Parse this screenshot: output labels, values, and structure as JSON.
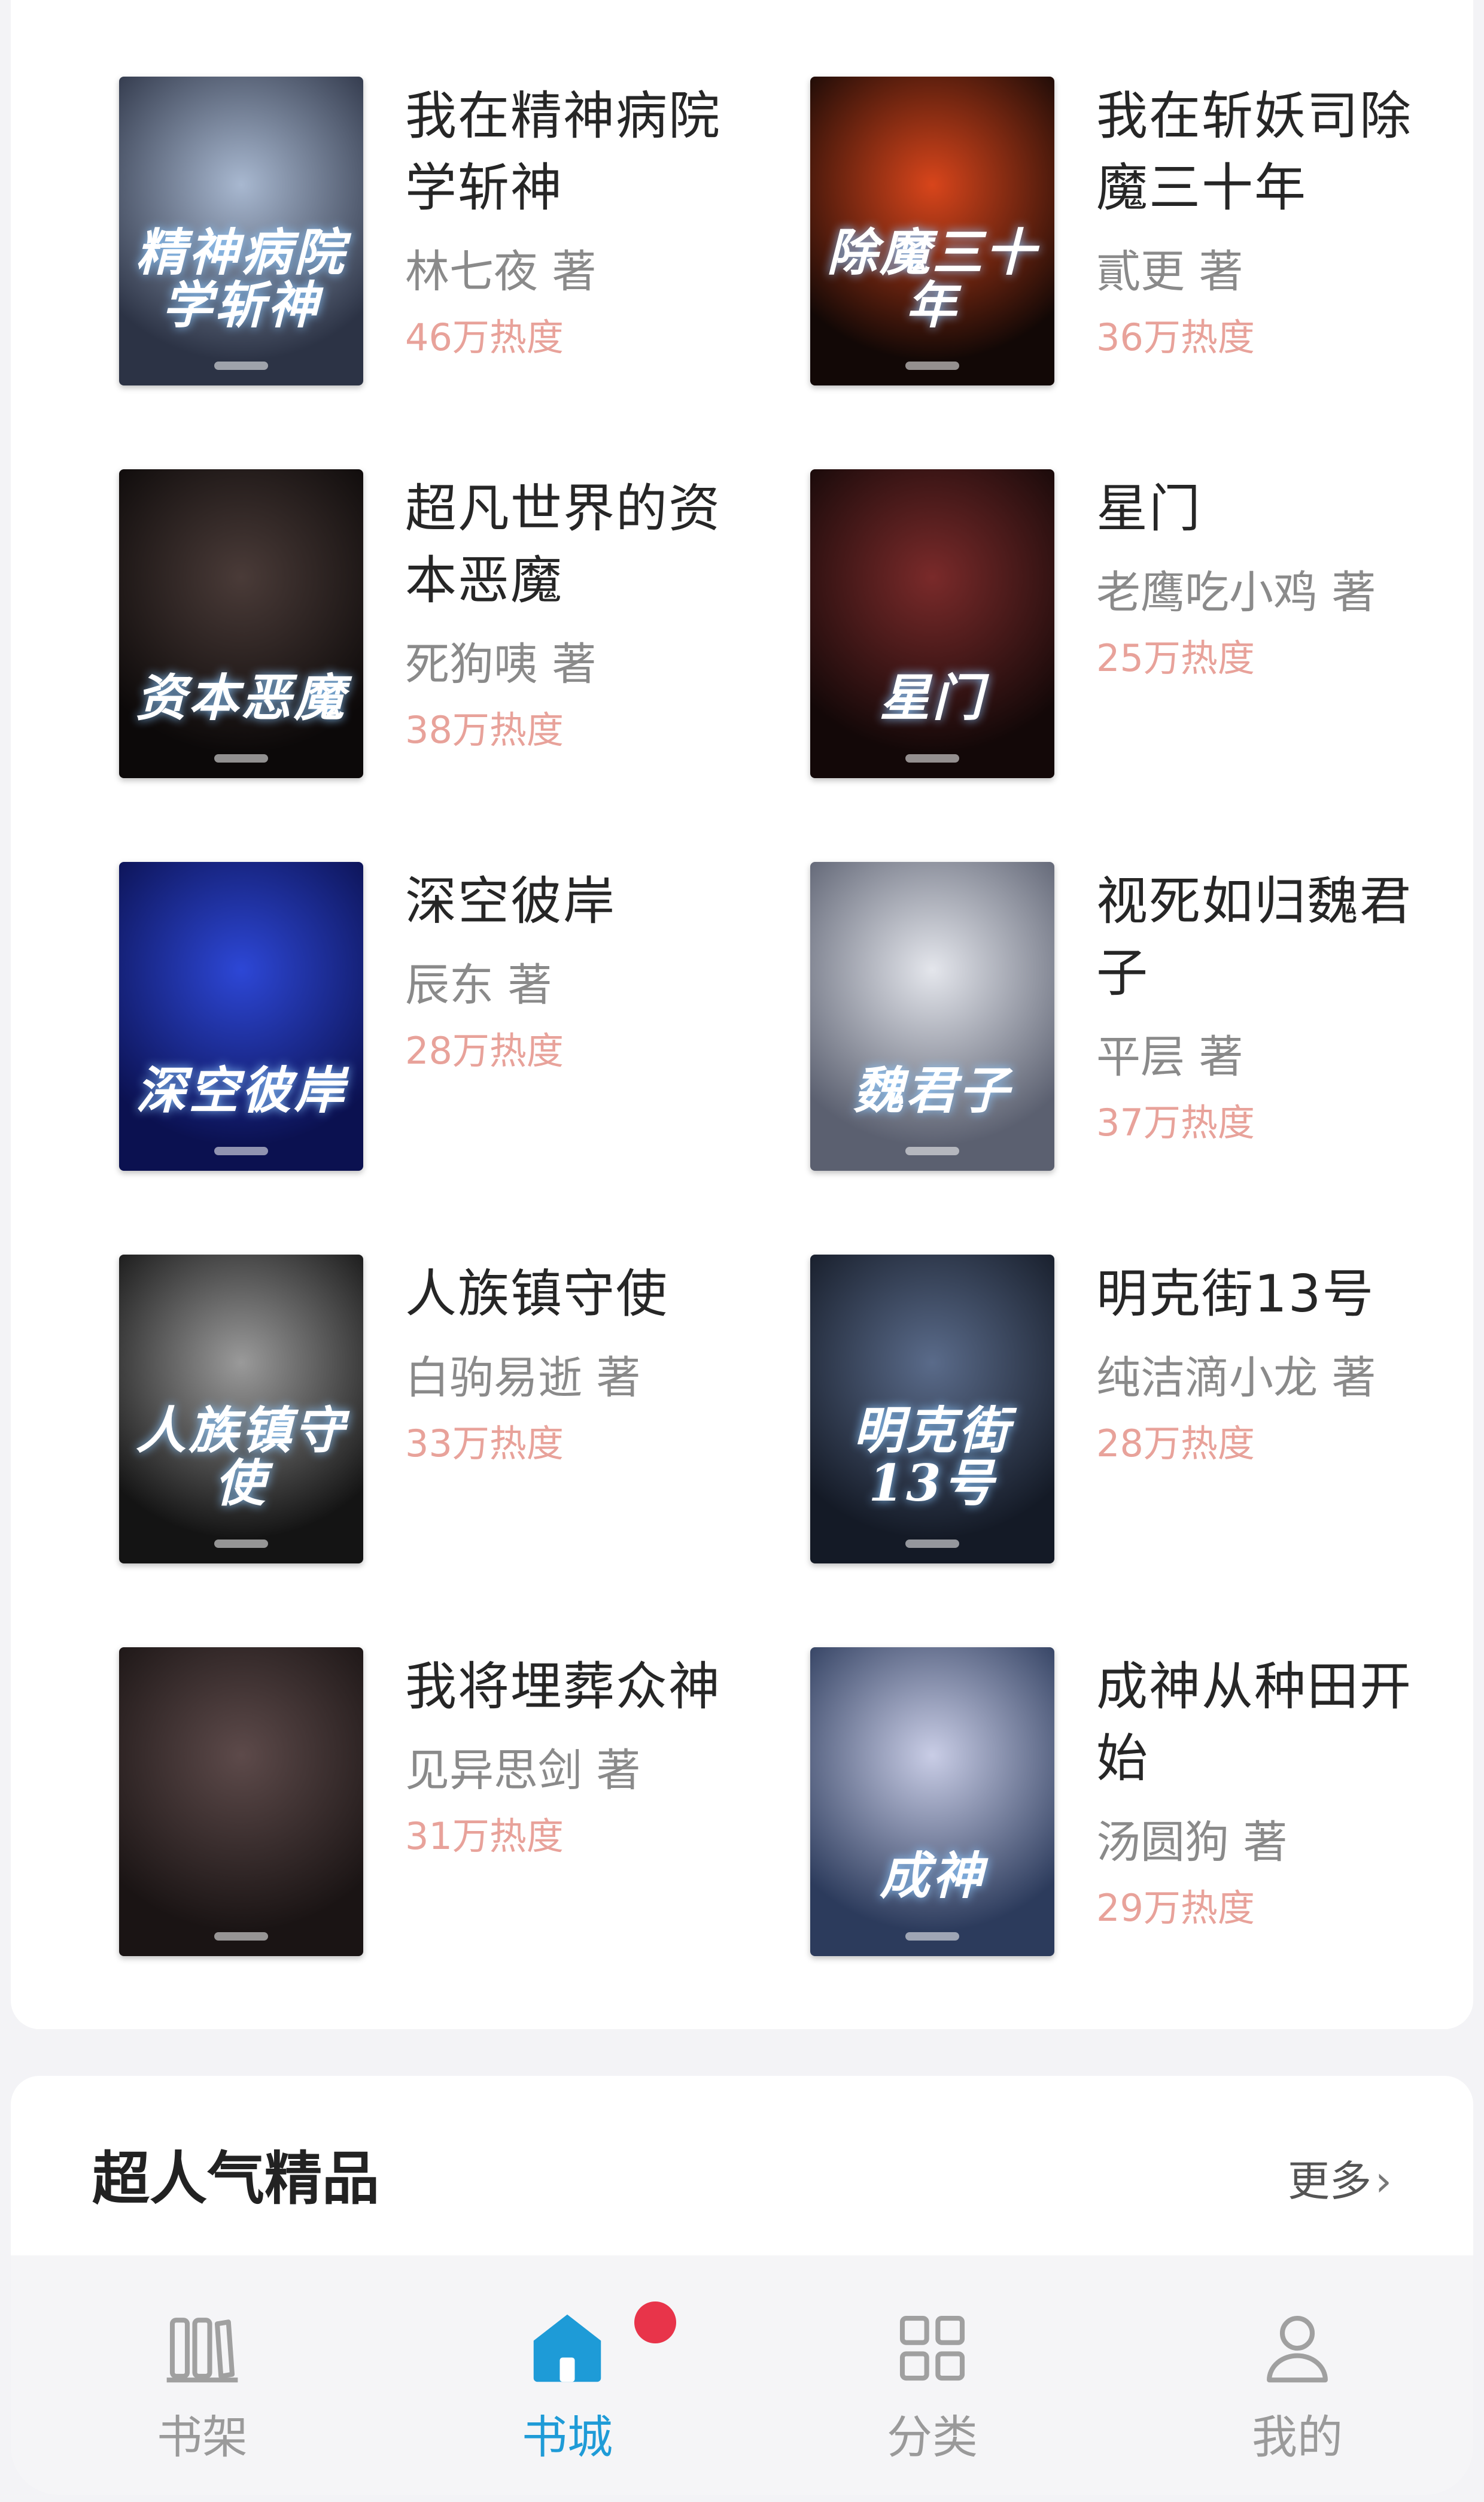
{
  "books": [
    {
      "title": "我在精神病院学斩神",
      "author": "林七夜 著",
      "heat": "46万热度",
      "cover_title": "精神病院学斩神",
      "cover_colors": [
        "#a8b8d0",
        "#2c3345"
      ]
    },
    {
      "title": "我在斩妖司除魔三十年",
      "author": "貳更 著",
      "heat": "36万热度",
      "cover_title": "除魔三十年",
      "cover_colors": [
        "#d8451b",
        "#120806"
      ]
    },
    {
      "title": "超凡世界的资本恶魔",
      "author": "死狗咦 著",
      "heat": "38万热度",
      "cover_title": "资本恶魔",
      "cover_colors": [
        "#4a3b38",
        "#0c0909"
      ]
    },
    {
      "title": "星门",
      "author": "老鹰吃小鸡 著",
      "heat": "25万热度",
      "cover_title": "星门",
      "cover_colors": [
        "#7a2a2a",
        "#130808"
      ]
    },
    {
      "title": "深空彼岸",
      "author": "辰东 著",
      "heat": "28万热度",
      "cover_title": "深空彼岸",
      "cover_colors": [
        "#2d47d6",
        "#0b1150"
      ]
    },
    {
      "title": "视死如归魏君子",
      "author": "平层 著",
      "heat": "37万热度",
      "cover_title": "魏君子",
      "cover_colors": [
        "#e4e6ec",
        "#5b6070"
      ]
    },
    {
      "title": "人族镇守使",
      "author": "白驹易逝 著",
      "heat": "33万热度",
      "cover_title": "人族镇守使",
      "cover_colors": [
        "#9a9a9a",
        "#141414"
      ]
    },
    {
      "title": "明克街13号",
      "author": "纯洁滴小龙 著",
      "heat": "28万热度",
      "cover_title": "明克街13号",
      "cover_colors": [
        "#5a6b8a",
        "#141a26"
      ]
    },
    {
      "title": "我将埋葬众神",
      "author": "见异思剑 著",
      "heat": "31万热度",
      "cover_title": "",
      "cover_colors": [
        "#5d4a4a",
        "#1a1414"
      ]
    },
    {
      "title": "成神从种田开始",
      "author": "汤圆狗 著",
      "heat": "29万热度",
      "cover_title": "成神",
      "cover_colors": [
        "#c9cde6",
        "#2c3b5c"
      ]
    }
  ],
  "section": {
    "title": "超人气精品",
    "more": "更多"
  },
  "tabbar": {
    "items": [
      {
        "label": "书架",
        "icon": "bookshelf-icon"
      },
      {
        "label": "书城",
        "icon": "home-icon"
      },
      {
        "label": "分类",
        "icon": "category-grid-icon"
      },
      {
        "label": "我的",
        "icon": "user-icon"
      }
    ],
    "active_index": 1
  },
  "colors": {
    "accent": "#1e9bd7",
    "heat": "#e8a29a",
    "badge": "#e8344a"
  }
}
